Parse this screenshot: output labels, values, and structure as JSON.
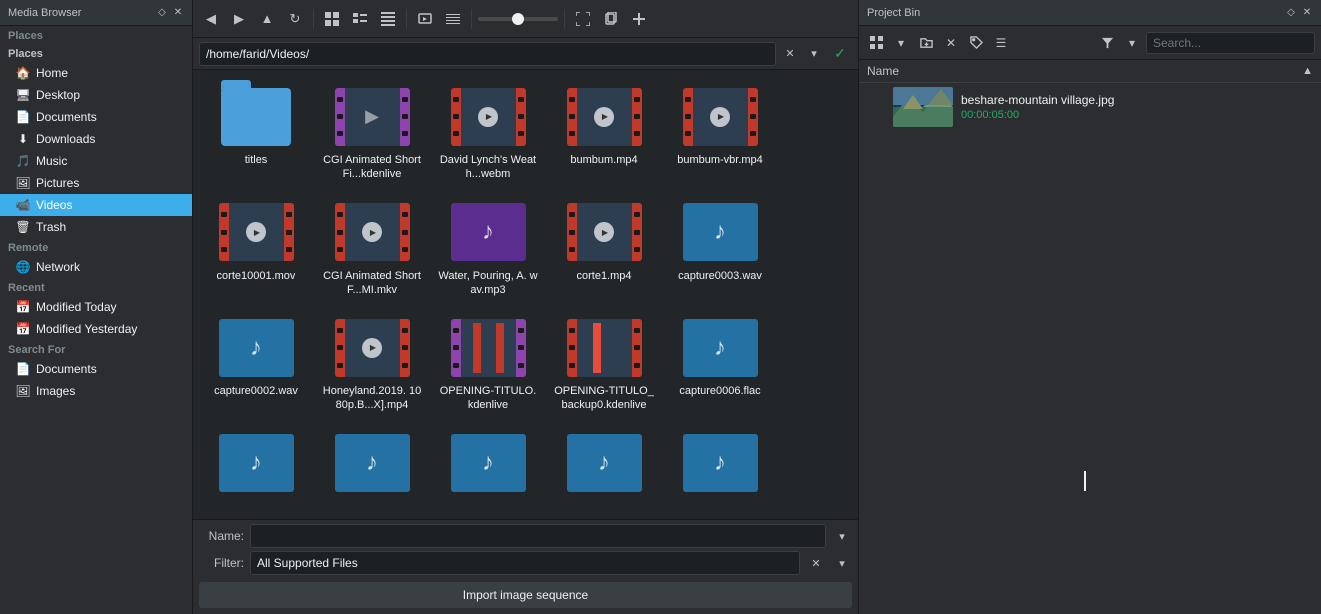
{
  "mediaBrowser": {
    "title": "Media Browser",
    "titleIcons": [
      "◇",
      "✕"
    ],
    "places": {
      "label": "Places",
      "items": [
        {
          "id": "home",
          "label": "Home",
          "icon": "🏠"
        },
        {
          "id": "desktop",
          "label": "Desktop",
          "icon": "🖥"
        },
        {
          "id": "documents",
          "label": "Documents",
          "icon": "📄"
        },
        {
          "id": "downloads",
          "label": "Downloads",
          "icon": "⬇"
        },
        {
          "id": "music",
          "label": "Music",
          "icon": "🎵"
        },
        {
          "id": "pictures",
          "label": "Pictures",
          "icon": "🖼"
        },
        {
          "id": "videos",
          "label": "Videos",
          "icon": "📹",
          "active": true
        },
        {
          "id": "trash",
          "label": "Trash",
          "icon": "🗑"
        }
      ]
    },
    "remote": {
      "label": "Remote",
      "items": [
        {
          "id": "network",
          "label": "Network",
          "icon": "🌐"
        }
      ]
    },
    "recent": {
      "label": "Recent",
      "items": [
        {
          "id": "modified-today",
          "label": "Modified Today",
          "icon": "📅"
        },
        {
          "id": "modified-yesterday",
          "label": "Modified Yesterday",
          "icon": "📅"
        }
      ]
    },
    "searchFor": {
      "label": "Search For",
      "items": [
        {
          "id": "documents-search",
          "label": "Documents",
          "icon": "📄"
        },
        {
          "id": "images",
          "label": "Images",
          "icon": "🖼"
        }
      ]
    }
  },
  "fileBrowser": {
    "toolbar": {
      "back": "◀",
      "forward": "▶",
      "up": "▲",
      "reload": "↻",
      "view_icons": "⊞",
      "view_details": "☰",
      "view_compact": "⊟",
      "preview": "🖼",
      "list": "≡",
      "zoom_value": 50,
      "btn_fs": "⛶",
      "btn_copy": "⊕",
      "btn_link": "↕"
    },
    "addressBar": {
      "path": "/home/farid/Videos/",
      "placeholder": "/home/farid/Videos/"
    },
    "files": [
      {
        "id": "titles",
        "name": "titles",
        "type": "folder"
      },
      {
        "id": "cgi-animated",
        "name": "CGI Animated Short Fi...kdenlive",
        "type": "kdenlive"
      },
      {
        "id": "david-lynch",
        "name": "David Lynch's Weath...webm",
        "type": "video"
      },
      {
        "id": "bumbum-mp4",
        "name": "bumbum.mp4",
        "type": "video"
      },
      {
        "id": "bumbum-vbr",
        "name": "bumbum-vbr.mp4",
        "type": "video"
      },
      {
        "id": "corte10001",
        "name": "corte10001.mov",
        "type": "video"
      },
      {
        "id": "cgi-animated-ml",
        "name": "CGI Animated Short F...MI.mkv",
        "type": "video"
      },
      {
        "id": "water-pouring",
        "name": "Water, Pouring, A. wav.mp3",
        "type": "audio"
      },
      {
        "id": "corte1",
        "name": "corte1.mp4",
        "type": "video"
      },
      {
        "id": "capture0003",
        "name": "capture0003.wav",
        "type": "audio"
      },
      {
        "id": "capture0002",
        "name": "capture0002.wav",
        "type": "audio"
      },
      {
        "id": "honeyland",
        "name": "Honeyland.2019. 1080p.B...X].mp4",
        "type": "video"
      },
      {
        "id": "opening-titulo",
        "name": "OPENING-TITULO. kdenlive",
        "type": "kdenlive"
      },
      {
        "id": "opening-titulo-bk",
        "name": "OPENING-TITULO_ backup0.kdenlive",
        "type": "kdenlive"
      },
      {
        "id": "capture0006",
        "name": "capture0006.flac",
        "type": "audio"
      },
      {
        "id": "audio1",
        "name": "",
        "type": "audio"
      },
      {
        "id": "audio2",
        "name": "",
        "type": "audio"
      },
      {
        "id": "audio3",
        "name": "",
        "type": "audio"
      },
      {
        "id": "audio4",
        "name": "",
        "type": "audio"
      },
      {
        "id": "audio5",
        "name": "",
        "type": "audio"
      }
    ],
    "bottomBar": {
      "nameLabel": "Name:",
      "namePlaceholder": "",
      "filterLabel": "Filter:",
      "filterValue": "All Supported Files",
      "importBtn": "Import image sequence"
    }
  },
  "projectBin": {
    "title": "Project Bin",
    "titleIcons": [
      "◇",
      "✕"
    ],
    "toolbar": {
      "btn1": "⊞",
      "btn2": "▾",
      "btn3": "📁",
      "btn4": "✕",
      "btn5": "🏷",
      "btn6": "☰",
      "filter": "▾",
      "searchPlaceholder": "Search..."
    },
    "nameHeader": "Name",
    "items": [
      {
        "id": "beshare",
        "name": "beshare-mountain village.jpg",
        "duration": "00:00:05:00",
        "type": "image",
        "thumbColors": [
          "#1a3a5c",
          "#2d6a4f",
          "#8B9467"
        ]
      }
    ]
  }
}
